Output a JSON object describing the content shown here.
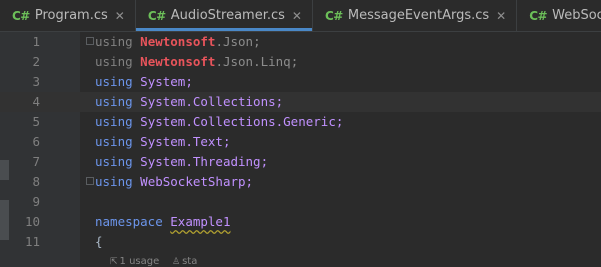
{
  "tabs": [
    {
      "lang": "C#",
      "label": "Program.cs",
      "close": "✕",
      "active": false
    },
    {
      "lang": "C#",
      "label": "AudioStreamer.cs",
      "close": "✕",
      "active": true
    },
    {
      "lang": "C#",
      "label": "MessageEventArgs.cs",
      "close": "✕",
      "active": false
    },
    {
      "lang": "C#",
      "label": "WebSocketFrame",
      "close": "",
      "active": false
    }
  ],
  "lines": [
    {
      "n": "1",
      "kw": "using",
      "pkg": "Newtonsoft",
      "rest": ".Json;",
      "dim": true
    },
    {
      "n": "2",
      "kw": "using",
      "pkg": "Newtonsoft",
      "rest": ".Json.Linq;",
      "dim": true
    },
    {
      "n": "3",
      "kw": "using",
      "ns": "System;"
    },
    {
      "n": "4",
      "kw": "using",
      "ns": "System.Collections;"
    },
    {
      "n": "5",
      "kw": "using",
      "ns": "System.Collections.Generic;"
    },
    {
      "n": "6",
      "kw": "using",
      "ns": "System.Text;"
    },
    {
      "n": "7",
      "kw": "using",
      "ns": "System.Threading;"
    },
    {
      "n": "8",
      "kw": "using",
      "ns": "WebSocketSharp;"
    },
    {
      "n": "9"
    },
    {
      "n": "10",
      "kw": "namespace",
      "ns": "Example1"
    },
    {
      "n": "11",
      "text": "{"
    }
  ],
  "hint": {
    "usages": "1 usage",
    "author": "sta"
  },
  "colors": {
    "background": "#2b2b2b",
    "gutter": "#313335",
    "accent": "#4a88c7",
    "keyword": "#6c95eb",
    "namespace": "#c191ff",
    "package": "#e8545b"
  }
}
